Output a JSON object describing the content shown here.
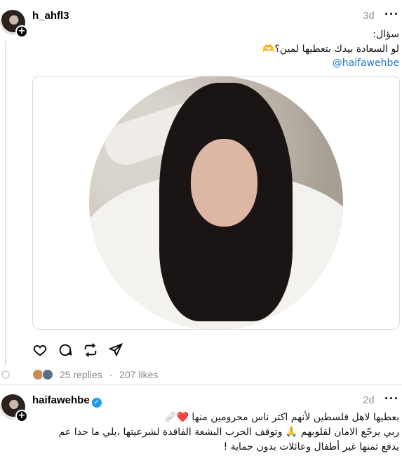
{
  "post1": {
    "username": "h_ahfl3",
    "time": "3d",
    "more_label": "···",
    "lines": [
      "سؤال:",
      "لو السعادة بيدك بتعطيها لمين؟🫶"
    ],
    "mention": "@haifawehbe",
    "media_alt": "portrait photo"
  },
  "actions": {
    "like_icon": "heart-icon",
    "reply_icon": "comment-icon",
    "repost_icon": "repost-icon",
    "share_icon": "send-icon"
  },
  "stats": {
    "replies": "25 replies",
    "separator": "·",
    "likes": "207 likes"
  },
  "reply": {
    "username": "haifawehbe",
    "time": "2d",
    "more_label": "···",
    "lines": [
      "بعطيها لاهل فلسطين لأنهم اكتر ناس محرومين منها ❤️🩹",
      "ربي يرجّع الامان لقلوبهم 🙏 وتوقف الحرب البشعة الفاقدة لشرعيتها ،يلي ما حدا عم",
      "يدفع ثمنها غير أطفال وعائلات بدون حماية !"
    ]
  },
  "colors": {
    "mention": "#1d74c9",
    "verified": "#1d9bf0",
    "muted": "#999999"
  }
}
